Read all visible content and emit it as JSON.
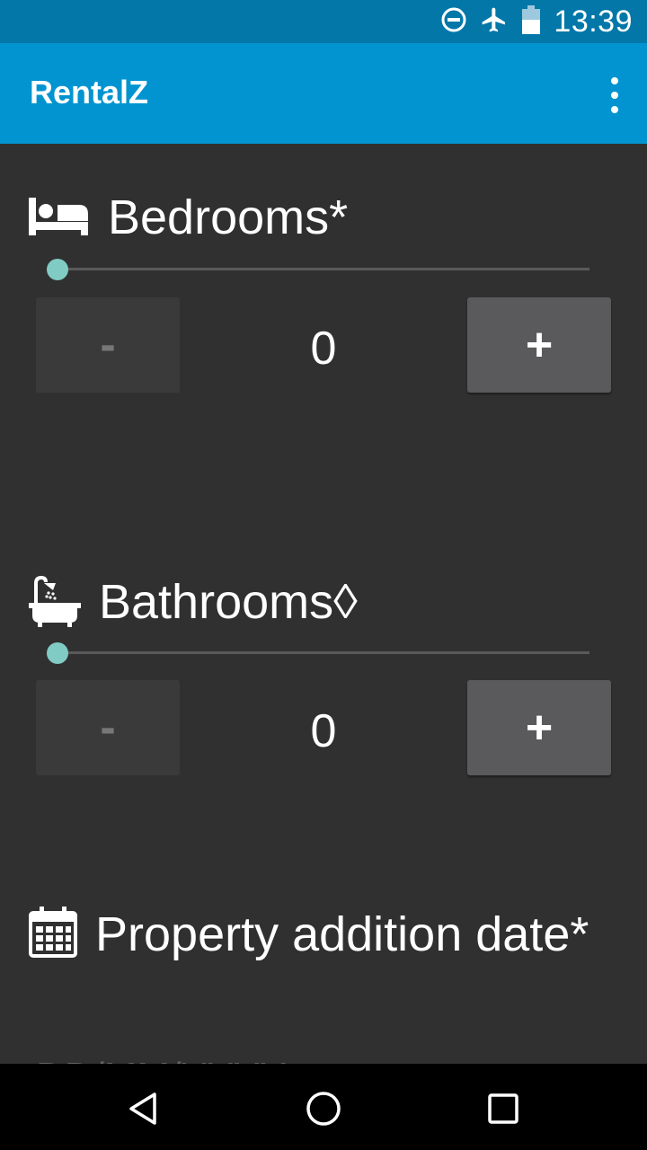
{
  "status_bar": {
    "time": "13:39",
    "icons": [
      "do-not-disturb-icon",
      "airplane-mode-icon",
      "battery-icon"
    ]
  },
  "app_bar": {
    "title": "RentalZ",
    "overflow_icon": "more-vert-icon"
  },
  "bedrooms": {
    "icon": "bed-icon",
    "title": "Bedrooms*",
    "slider_value": 0,
    "minus_label": "-",
    "value": "0",
    "plus_label": "+"
  },
  "bathrooms": {
    "icon": "bathtub-icon",
    "title": "Bathrooms◊",
    "slider_value": 0,
    "minus_label": "-",
    "value": "0",
    "plus_label": "+"
  },
  "property_date": {
    "icon": "calendar-icon",
    "title": "Property addition date*",
    "placeholder": "DD/MM/YYYY"
  },
  "colors": {
    "status_bar": "#0277a8",
    "app_bar": "#0294d0",
    "background": "#303030",
    "slider_thumb": "#80cbc4"
  },
  "nav_bar": {
    "icons": [
      "back-icon",
      "home-icon",
      "recents-icon"
    ]
  }
}
